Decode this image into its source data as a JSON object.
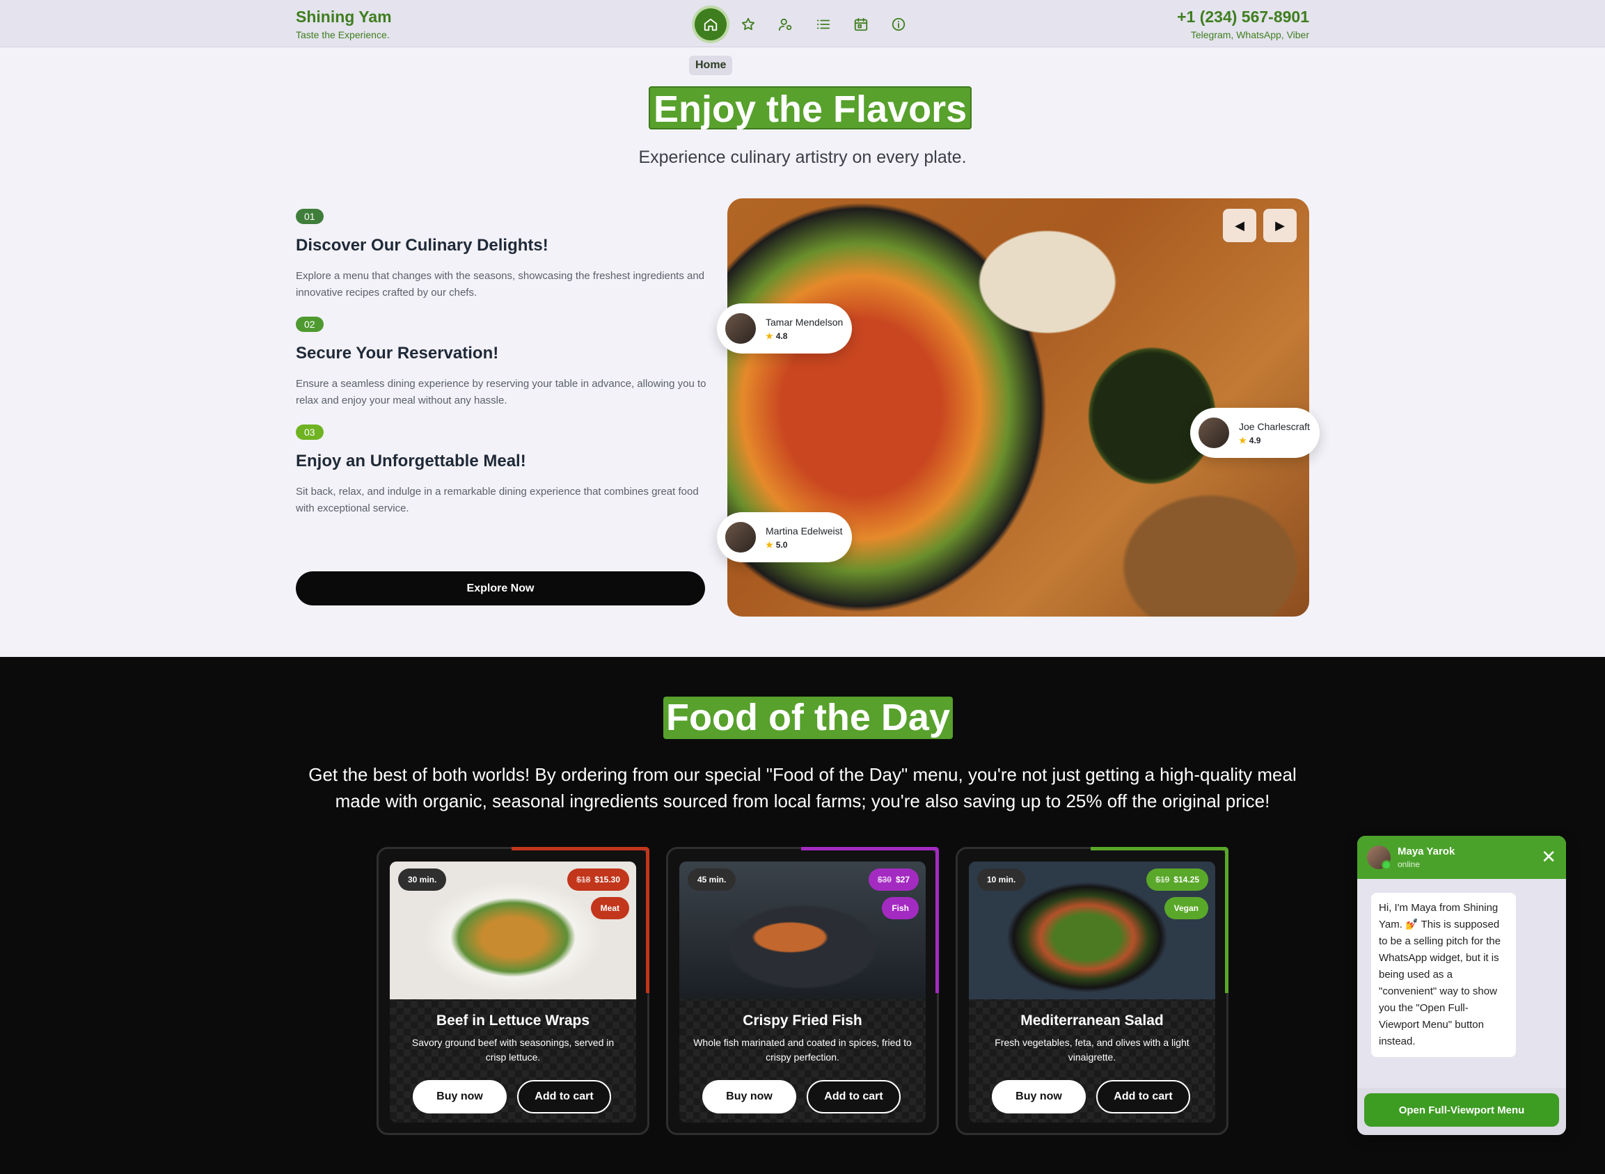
{
  "header": {
    "brand_name": "Shining Yam",
    "brand_tagline": "Taste the Experience.",
    "phone": "+1 (234) 567-8901",
    "channels": "Telegram, WhatsApp, Viber",
    "nav_items": [
      {
        "icon": "home-icon",
        "active": true
      },
      {
        "icon": "star-icon"
      },
      {
        "icon": "user-icon"
      },
      {
        "icon": "list-icon"
      },
      {
        "icon": "calendar-icon"
      },
      {
        "icon": "info-icon"
      }
    ],
    "active_label": "Home"
  },
  "hero": {
    "title": "Enjoy the Flavors",
    "subtitle": "Experience culinary artistry on every plate.",
    "steps": [
      {
        "num": "01",
        "title": "Discover Our Culinary Delights!",
        "text": "Explore a menu that changes with the seasons, showcasing the freshest ingredients and innovative recipes crafted by our chefs.",
        "color": "#3f7e3a"
      },
      {
        "num": "02",
        "title": "Secure Your Reservation!",
        "text": "Ensure a seamless dining experience by reserving your table in advance, allowing you to relax and enjoy your meal without any hassle.",
        "color": "#4f9a30"
      },
      {
        "num": "03",
        "title": "Enjoy an Unforgettable Meal!",
        "text": "Sit back, relax, and indulge in a remarkable dining experience that combines great food with exceptional service.",
        "color": "#6fb323"
      }
    ],
    "cta": "Explore Now",
    "slider_prev": "◀",
    "slider_next": "▶",
    "reviews": [
      {
        "name": "Tamar Mendelson",
        "rating": "4.8"
      },
      {
        "name": "Joe Charlescraft",
        "rating": "4.9"
      },
      {
        "name": "Martina Edelweist",
        "rating": "5.0"
      }
    ]
  },
  "food_of_day": {
    "title": "Food of the Day",
    "text": "Get the best of both worlds! By ordering from our special \"Food of the Day\" menu, you're not just getting a high-quality meal made with organic, seasonal ingredients sourced from local farms; you're also saving up to 25% off the original price!",
    "cards": [
      {
        "time": "30 min.",
        "old_price": "$18",
        "price": "$15.30",
        "category": "Meat",
        "title": "Beef in Lettuce Wraps",
        "desc": "Savory ground beef with seasonings, served in crisp lettuce.",
        "buy": "Buy now",
        "cart": "Add to cart",
        "accent": "#c2361c"
      },
      {
        "time": "45 min.",
        "old_price": "$30",
        "price": "$27",
        "category": "Fish",
        "title": "Crispy Fried Fish",
        "desc": "Whole fish marinated and coated in spices, fried to crispy perfection.",
        "buy": "Buy now",
        "cart": "Add to cart",
        "accent": "#a42bc2"
      },
      {
        "time": "10 min.",
        "old_price": "$19",
        "price": "$14.25",
        "category": "Vegan",
        "title": "Mediterranean Salad",
        "desc": "Fresh vegetables, feta, and olives with a light vinaigrette.",
        "buy": "Buy now",
        "cart": "Add to cart",
        "accent": "#5aa82a"
      }
    ]
  },
  "chat": {
    "name": "Maya Yarok",
    "status": "online",
    "message": "Hi, I'm Maya from Shining Yam. 💅 This is supposed to be a selling pitch for the WhatsApp widget, but it is being used as a \"convenient\" way to show you the \"Open Full-Viewport Menu\" button instead.",
    "close": "✕",
    "button": "Open Full-Viewport Menu"
  }
}
